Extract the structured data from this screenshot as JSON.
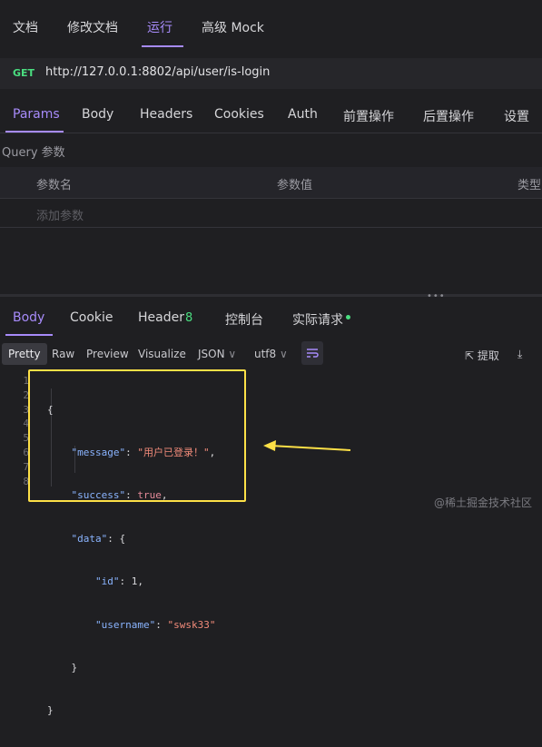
{
  "top_tabs": [
    {
      "label": "文档"
    },
    {
      "label": "修改文档"
    },
    {
      "label": "运行"
    },
    {
      "label": "高级 Mock"
    }
  ],
  "request": {
    "method": "GET",
    "url": "http://127.0.0.1:8802/api/user/is-login"
  },
  "param_tabs": [
    {
      "label": "Params"
    },
    {
      "label": "Body"
    },
    {
      "label": "Headers"
    },
    {
      "label": "Cookies"
    },
    {
      "label": "Auth"
    },
    {
      "label": "前置操作"
    },
    {
      "label": "后置操作"
    },
    {
      "label": "设置"
    }
  ],
  "query": {
    "title": "Query 参数",
    "col_name": "参数名",
    "col_value": "参数值",
    "col_type": "类型",
    "add_param": "添加参数"
  },
  "response_tabs": [
    {
      "label": "Body"
    },
    {
      "label": "Cookie"
    },
    {
      "label": "Header"
    },
    {
      "label": "控制台"
    },
    {
      "label": "实际请求"
    }
  ],
  "header_count": "8",
  "view_buttons": [
    {
      "label": "Pretty"
    },
    {
      "label": "Raw"
    },
    {
      "label": "Preview"
    },
    {
      "label": "Visualize"
    }
  ],
  "format_select": "JSON",
  "encoding_select": "utf8",
  "extract_label": "提取",
  "code": {
    "line_numbers": [
      "1",
      "2",
      "3",
      "4",
      "5",
      "6",
      "7",
      "8"
    ],
    "message_key": "\"message\"",
    "message_val": "\"用户已登录！\"",
    "success_key": "\"success\"",
    "success_val": "true",
    "data_key": "\"data\"",
    "id_key": "\"id\"",
    "id_val": "1",
    "username_key": "\"username\"",
    "username_val": "\"swsk33\""
  },
  "watermark": "@稀土掘金技术社区",
  "colors": {
    "accent": "#a78bfa",
    "method": "#4ade80",
    "highlight_box": "#fde047",
    "arrow": "#fde047"
  }
}
